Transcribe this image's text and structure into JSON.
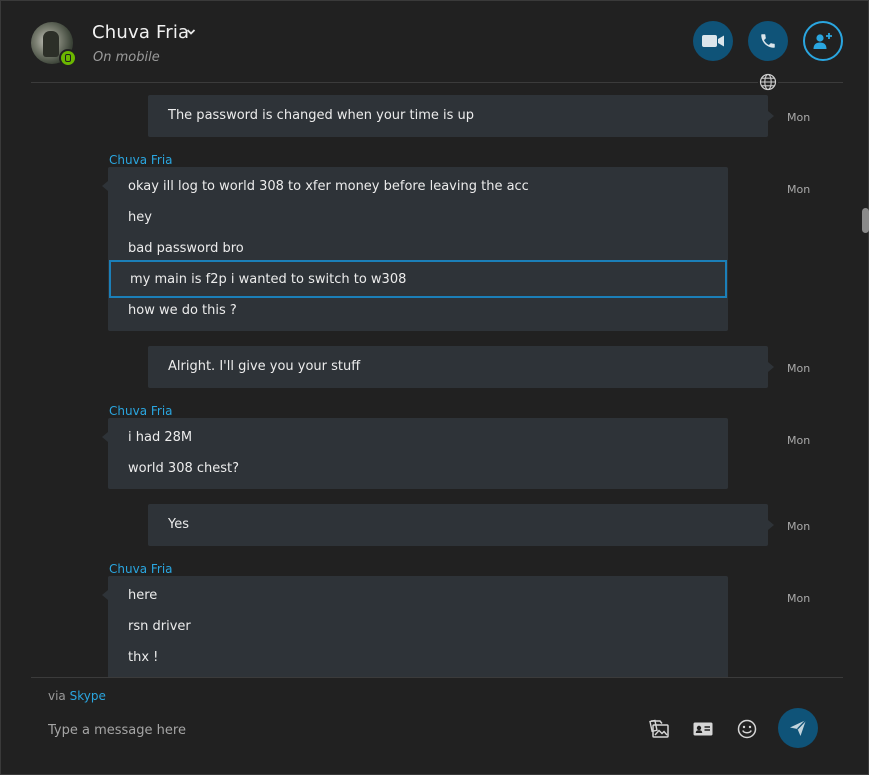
{
  "header": {
    "contact_name": "Chuva Fria",
    "status": "On mobile",
    "video_call_icon": "video-camera-icon",
    "audio_call_icon": "phone-icon",
    "add_people_icon": "add-person-icon",
    "translate_icon": "globe-icon"
  },
  "conversation": {
    "outgoing_1": {
      "text": "The password is changed when your time is up",
      "time": "Mon"
    },
    "group_1": {
      "sender": "Chuva Fria",
      "time": "Mon",
      "lines": [
        "okay ill log to world 308 to xfer money before leaving the acc",
        "hey",
        "bad password bro",
        "my main is f2p i wanted to switch to w308",
        "how we do this ?"
      ]
    },
    "outgoing_2": {
      "text": "Alright. I'll give you your stuff",
      "time": "Mon"
    },
    "group_2": {
      "sender": "Chuva Fria",
      "time": "Mon",
      "lines": [
        "i had 28M",
        "world 308 chest?"
      ]
    },
    "outgoing_3": {
      "text": "Yes",
      "time": "Mon"
    },
    "group_3": {
      "sender": "Chuva Fria",
      "time": "Mon",
      "lines": [
        "here",
        "rsn driver",
        "thx !"
      ]
    }
  },
  "composer": {
    "via_prefix": "via",
    "via_link": "Skype",
    "placeholder": "Type a message here",
    "tools": [
      "gallery-icon",
      "contact-card-icon",
      "emoji-icon"
    ],
    "send_icon": "send-icon"
  },
  "colors": {
    "accent": "#2aa6e0",
    "button_fill": "#0f5378",
    "bubble": "#2e3338",
    "background": "#212121",
    "presence": "#6bb700"
  }
}
